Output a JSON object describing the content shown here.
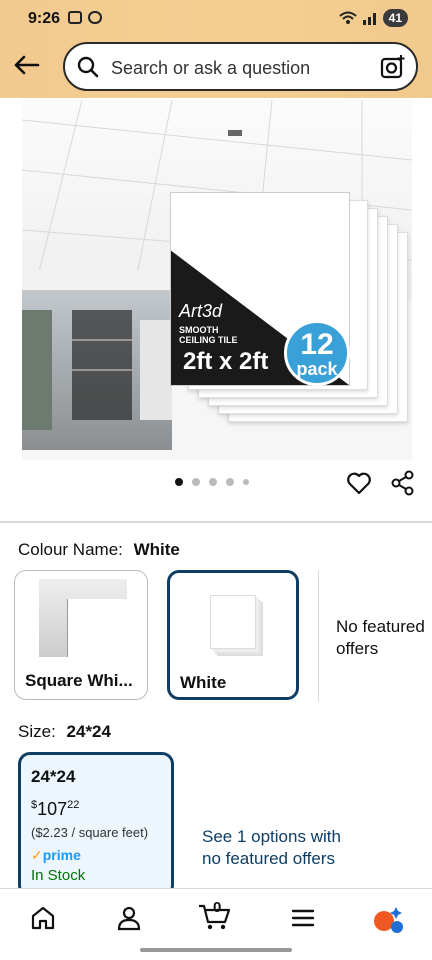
{
  "status_bar": {
    "time": "9:26",
    "battery": "41"
  },
  "search": {
    "placeholder": "Search or ask a question"
  },
  "product_image": {
    "brand": "Art3d",
    "tag_line1": "SMOOTH",
    "tag_line2": "CEILING TILE",
    "size_text": "2ft x 2ft",
    "pack_number": "12",
    "pack_word": "pack"
  },
  "carousel": {
    "dots": 5,
    "active_index": 0
  },
  "colour": {
    "label": "Colour Name:",
    "selected": "White",
    "options": [
      {
        "name": "Square Whi..."
      },
      {
        "name": "White"
      }
    ],
    "no_featured": "No featured offers"
  },
  "size": {
    "label": "Size:",
    "selected": "24*24",
    "card": {
      "title": "24*24",
      "price_symbol": "$",
      "price_whole": "107",
      "price_fraction": "22",
      "unit_price": "($2.23 / square feet)",
      "prime": "prime",
      "stock": "In Stock"
    },
    "see_options_line1": "See 1 options with",
    "see_options_line2": "no featured offers"
  },
  "bottom_nav": {
    "cart_count": "0"
  },
  "colors": {
    "header_bg": "#f2c98f",
    "selected_border": "#0f3d64",
    "link": "#0f3d64",
    "stock_green": "#007600",
    "prime_blue": "#1a98ff"
  }
}
